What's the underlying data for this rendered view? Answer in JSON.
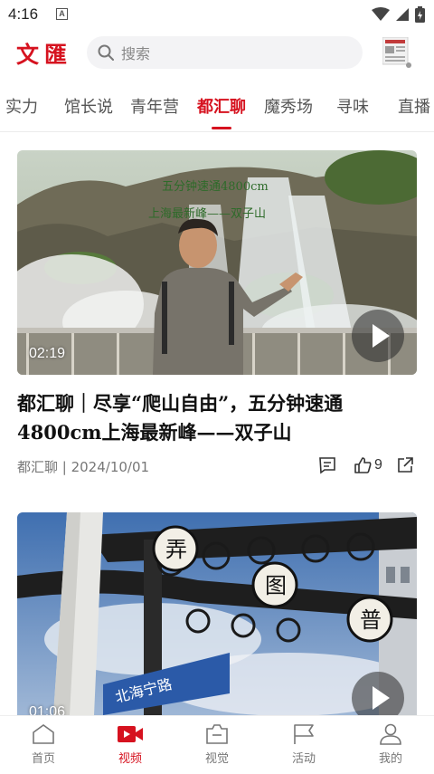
{
  "status_bar": {
    "time": "4:16",
    "notification_icon": "A"
  },
  "header": {
    "logo": "文匯",
    "search_placeholder": "搜索",
    "newspaper_icon": "newspaper-icon"
  },
  "tabs": [
    {
      "label": "实力"
    },
    {
      "label": "馆长说"
    },
    {
      "label": "青年营"
    },
    {
      "label": "都汇聊",
      "active": true
    },
    {
      "label": "魔秀场"
    },
    {
      "label": "寻味"
    },
    {
      "label": "直播"
    }
  ],
  "cards": [
    {
      "duration": "02:19",
      "title": "都汇聊｜尽享“爬山自由”，五分钟速通4800cm上海最新峰——双子山",
      "meta": "都汇聊 | 2024/10/01",
      "likes": "9",
      "overlay_text_1": "五分钟速通4800cm",
      "overlay_text_2": "上海最新峰——双子山"
    },
    {
      "duration": "01:06",
      "sign_text": [
        "弄",
        "图",
        "普"
      ],
      "street_sign": "北海宁路"
    }
  ],
  "bottom_nav": [
    {
      "label": "首页",
      "icon": "home-icon"
    },
    {
      "label": "视频",
      "icon": "video-icon",
      "active": true
    },
    {
      "label": "视觉",
      "icon": "camera-icon"
    },
    {
      "label": "活动",
      "icon": "flag-icon"
    },
    {
      "label": "我的",
      "icon": "user-icon"
    }
  ],
  "colors": {
    "accent": "#d6121f"
  }
}
